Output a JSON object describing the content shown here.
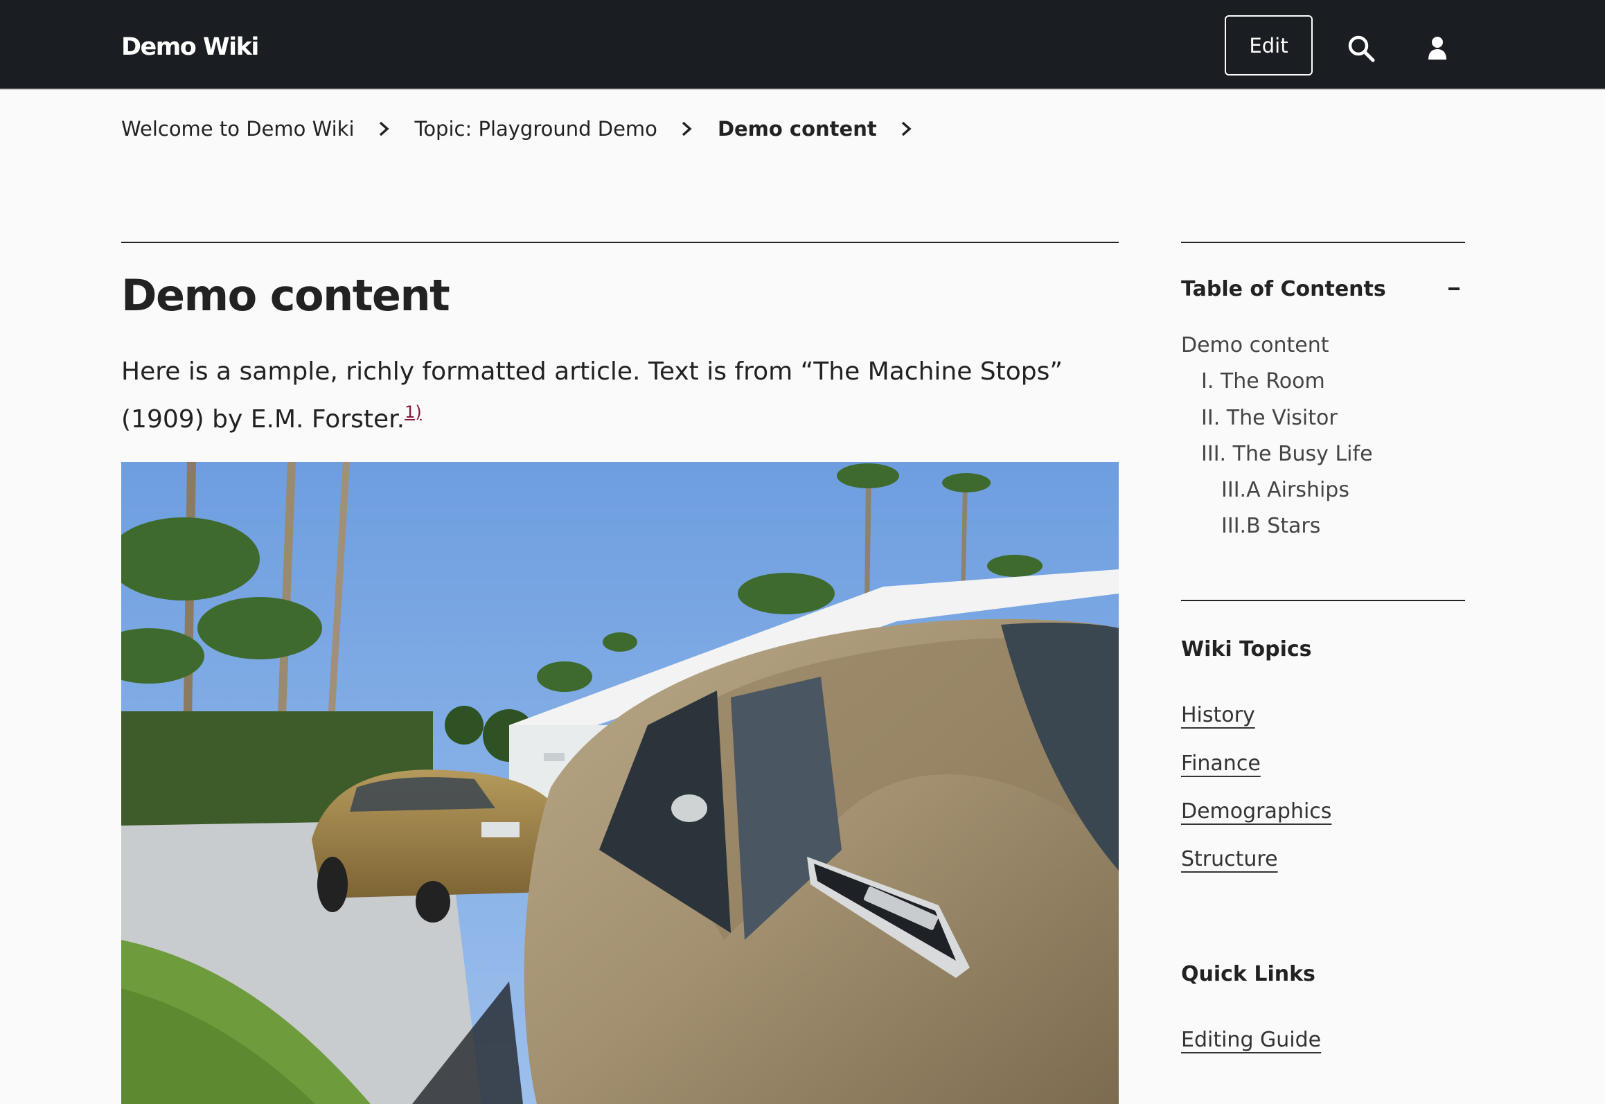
{
  "header": {
    "site_title": "Demo Wiki",
    "edit_label": "Edit",
    "icons": [
      "search-icon",
      "user-icon"
    ]
  },
  "breadcrumb": [
    {
      "label": "Welcome to Demo Wiki"
    },
    {
      "label": "Topic: Playground Demo"
    },
    {
      "label": "Demo content"
    }
  ],
  "article": {
    "title": "Demo content",
    "intro": "Here is a sample, richly formatted article. Text is from “The Machine Stops” (1909) by E.M. Forster.",
    "footnote_ref": "1)"
  },
  "toc": {
    "title": "Table of Contents",
    "items": [
      {
        "label": "Demo content",
        "level": 0
      },
      {
        "label": "I. The Room",
        "level": 1
      },
      {
        "label": "II. The Visitor",
        "level": 1
      },
      {
        "label": "III. The Busy Life",
        "level": 1
      },
      {
        "label": "III.A Airships",
        "level": 2
      },
      {
        "label": "III.B Stars",
        "level": 2
      }
    ]
  },
  "wiki_topics": {
    "title": "Wiki Topics",
    "items": [
      "History",
      "Finance",
      "Demographics",
      "Structure"
    ]
  },
  "quick_links": {
    "title": "Quick Links",
    "items": [
      "Editing Guide"
    ]
  },
  "colors": {
    "header_bg": "#1a1d21",
    "page_bg": "#fafafa",
    "text": "#222222",
    "footnote": "#8a1538"
  }
}
